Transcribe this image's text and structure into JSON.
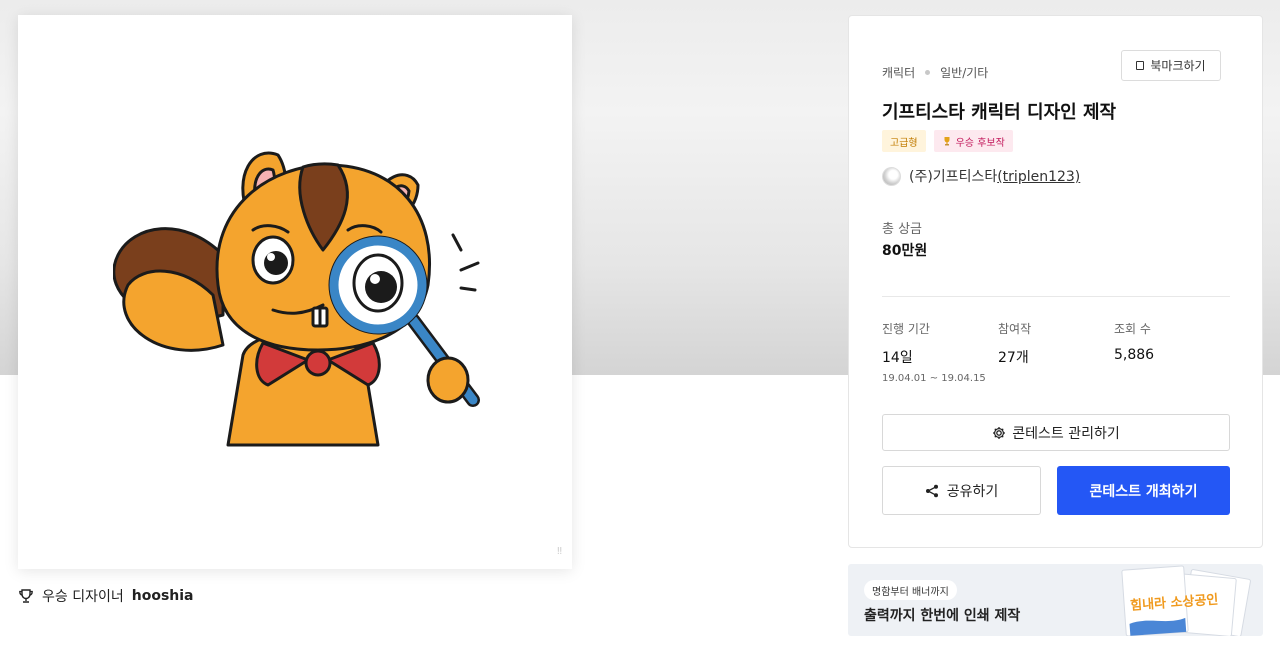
{
  "artwork": {
    "corner_mark": "‼"
  },
  "winner": {
    "prefix": "우승 디자이너",
    "name": "hooshia"
  },
  "contest": {
    "category": "캐릭터",
    "subcategory": "일반/기타",
    "bookmark_label": "북마크하기",
    "title": "기프티스타 캐릭터 디자인 제작",
    "badges": [
      "고급형",
      "우승 후보작"
    ],
    "owner_name": "(주)기프티스타",
    "owner_handle": "(triplen123)",
    "prize_label": "총 상금",
    "prize_value": "80만원",
    "stats": {
      "period_label": "진행 기간",
      "period_value": "14일",
      "period_range": "19.04.01 ~ 19.04.15",
      "entries_label": "참여작",
      "entries_value": "27개",
      "views_label": "조회 수",
      "views_value": "5,886"
    },
    "manage_label": "콘테스트 관리하기",
    "share_label": "공유하기",
    "host_label": "콘테스트 개최하기"
  },
  "banner": {
    "tag": "명함부터 배너까지",
    "text": "출력까지 한번에 인쇄 제작",
    "image_text": "힘내라 소상공인"
  },
  "colors": {
    "primary": "#2457f5",
    "squirrel_orange": "#f4a42e",
    "squirrel_brown": "#7a3f1c",
    "magnifier_blue": "#3a86c6",
    "bowtie_red": "#d23a3a"
  }
}
